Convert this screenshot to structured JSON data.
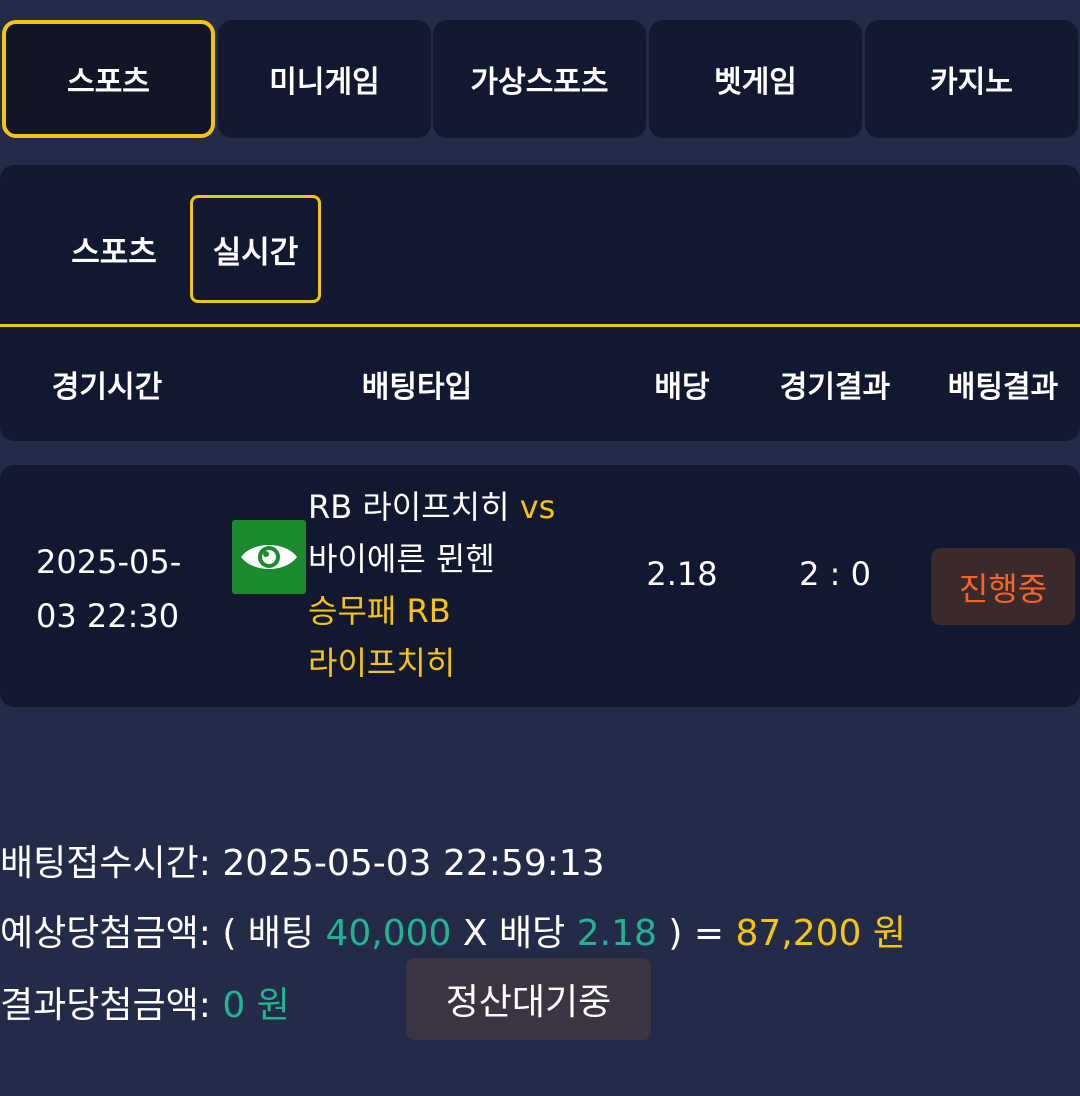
{
  "category_tabs": [
    {
      "label": "스포츠",
      "active": true
    },
    {
      "label": "미니게임",
      "active": false
    },
    {
      "label": "가상스포츠",
      "active": false
    },
    {
      "label": "벳게임",
      "active": false
    },
    {
      "label": "카지노",
      "active": false
    }
  ],
  "sub_tabs": [
    {
      "label": "스포츠",
      "active": false
    },
    {
      "label": "실시간",
      "active": true
    }
  ],
  "table": {
    "headers": [
      "경기시간",
      "배팅타입",
      "배당",
      "경기결과",
      "배팅결과"
    ],
    "row": {
      "time_line1": "2025-05-",
      "time_line2": "03 22:30",
      "icon": "eye-icon",
      "home_team": "RB 라이프치히",
      "vs": "vs",
      "away_team": "바이에른 뮌헨",
      "bet_line1": "승무패 RB",
      "bet_line2": "라이프치히",
      "odds": "2.18",
      "score": "2 : 0",
      "status": "진행중"
    }
  },
  "summary": {
    "accept_label": "배팅접수시간:",
    "accept_time": "2025-05-03 22:59:13",
    "expected_label": "예상당첨금액:",
    "open_paren": "( 배팅",
    "bet_amount": "40,000",
    "times_label": "X 배당",
    "odds": "2.18",
    "close_paren": ") =",
    "expected_amount": "87,200 원",
    "result_label": "결과당첨금액:",
    "result_amount": "0 원",
    "settle_button": "정산대기중"
  },
  "colors": {
    "background": "#242b49",
    "panel": "#131831",
    "accent_gold": "#f5c311",
    "accent_green": "#23b392",
    "status_orange": "#f5642a",
    "eye_button": "#1c8a2e"
  }
}
